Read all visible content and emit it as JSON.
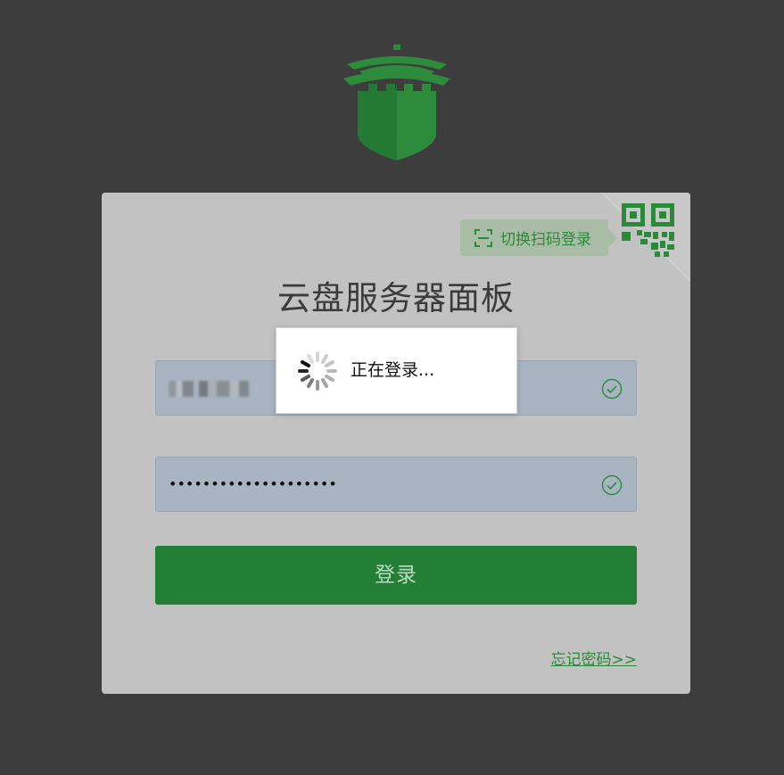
{
  "page": {
    "background_color": "#3d3d3d"
  },
  "logo": {
    "icon": "castle-shield-logo",
    "color": "#2d8c3c"
  },
  "login_card": {
    "title": "云盘服务器面板",
    "background_color": "#c2c2c2",
    "qr_switch": {
      "label": "切换扫码登录",
      "icon": "scan-icon",
      "corner_icon": "qr-code-icon"
    },
    "username_field": {
      "value": "",
      "note": "",
      "validation_icon": "check-circle-icon"
    },
    "password_field": {
      "value": "••••••••••••••••••••",
      "validation_icon": "check-circle-icon"
    },
    "login_button": {
      "label": "登录",
      "color": "#237f36"
    },
    "forgot_password": {
      "label": "忘记密码>>"
    }
  },
  "loading_dialog": {
    "text": "正在登录...",
    "icon": "spinner-icon"
  },
  "colors": {
    "accent_green": "#2a8a3a",
    "field_background": "#a8b4c1"
  }
}
